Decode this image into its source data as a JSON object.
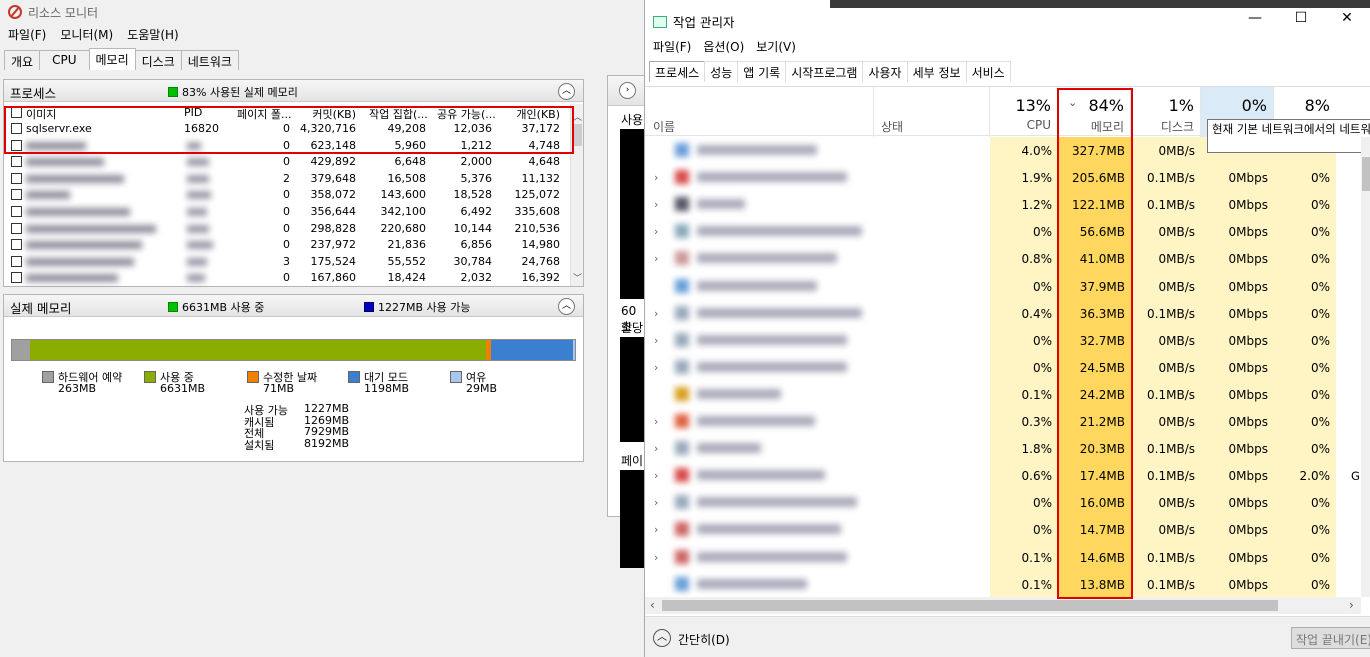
{
  "resource_monitor": {
    "title": "리소스 모니터",
    "menu": [
      "파일(F)",
      "모니터(M)",
      "도움말(H)"
    ],
    "tabs": [
      "개요",
      "CPU",
      "메모리",
      "디스크",
      "네트워크"
    ],
    "active_tab": "메모리",
    "process_panel": {
      "title": "프로세스",
      "summary": "83% 사용된 실제 메모리",
      "columns": [
        "이미지",
        "PID",
        "페이지 폴...",
        "커밋(KB)",
        "작업 집합(...",
        "공유 가능(...",
        "개인(KB)"
      ],
      "rows": [
        {
          "image": "sqlservr.exe",
          "pid": "16820",
          "faults": "0",
          "commit": "4,320,716",
          "working": "49,208",
          "shareable": "12,036",
          "private": "37,172"
        },
        {
          "image": "",
          "pid": "",
          "faults": "0",
          "commit": "623,148",
          "working": "5,960",
          "shareable": "1,212",
          "private": "4,748"
        },
        {
          "image": "",
          "pid": "",
          "faults": "0",
          "commit": "429,892",
          "working": "6,648",
          "shareable": "2,000",
          "private": "4,648"
        },
        {
          "image": "",
          "pid": "",
          "faults": "2",
          "commit": "379,648",
          "working": "16,508",
          "shareable": "5,376",
          "private": "11,132"
        },
        {
          "image": "",
          "pid": "",
          "faults": "0",
          "commit": "358,072",
          "working": "143,600",
          "shareable": "18,528",
          "private": "125,072"
        },
        {
          "image": "",
          "pid": "",
          "faults": "0",
          "commit": "356,644",
          "working": "342,100",
          "shareable": "6,492",
          "private": "335,608"
        },
        {
          "image": "",
          "pid": "",
          "faults": "0",
          "commit": "298,828",
          "working": "220,680",
          "shareable": "10,144",
          "private": "210,536"
        },
        {
          "image": "",
          "pid": "",
          "faults": "0",
          "commit": "237,972",
          "working": "21,836",
          "shareable": "6,856",
          "private": "14,980"
        },
        {
          "image": "",
          "pid": "",
          "faults": "3",
          "commit": "175,524",
          "working": "55,552",
          "shareable": "30,784",
          "private": "24,768"
        },
        {
          "image": "",
          "pid": "",
          "faults": "0",
          "commit": "167,860",
          "working": "18,424",
          "shareable": "2,032",
          "private": "16,392"
        }
      ]
    },
    "physical_memory": {
      "title": "실제 메모리",
      "in_use_badge": "6631MB 사용 중",
      "available_badge": "1227MB 사용 가능",
      "bar": {
        "hardware": 263,
        "in_use": 6631,
        "modified": 71,
        "standby": 1198,
        "free": 29
      },
      "legend": [
        {
          "label": "하드웨어 예약",
          "value": "263MB",
          "color": "#a0a0a0"
        },
        {
          "label": "사용 중",
          "value": "6631MB",
          "color": "#8bac00"
        },
        {
          "label": "수정한 날짜",
          "value": "71MB",
          "color": "#f08000"
        },
        {
          "label": "대기 모드",
          "value": "1198MB",
          "color": "#3a7fd0"
        },
        {
          "label": "여유",
          "value": "29MB",
          "color": "#a9c6ec"
        }
      ],
      "stats": [
        {
          "label": "사용 가능",
          "value": "1227MB"
        },
        {
          "label": "캐시됨",
          "value": "1269MB"
        },
        {
          "label": "전체",
          "value": "7929MB"
        },
        {
          "label": "설치됨",
          "value": "8192MB"
        }
      ]
    },
    "graph_panel": {
      "labels": [
        "사용",
        "60초",
        "할당",
        "페이"
      ]
    }
  },
  "task_manager": {
    "title": "작업 관리자",
    "window_buttons": [
      "—",
      "☐",
      "✕"
    ],
    "menu": [
      "파일(F)",
      "옵션(O)",
      "보기(V)"
    ],
    "tabs": [
      "프로세스",
      "성능",
      "앱 기록",
      "시작프로그램",
      "사용자",
      "세부 정보",
      "서비스"
    ],
    "active_tab": "프로세스",
    "columns": {
      "name": "이름",
      "status": "상태",
      "cpu": {
        "pct": "13%",
        "label": "CPU"
      },
      "memory": {
        "pct": "84%",
        "label": "메모리"
      },
      "disk": {
        "pct": "1%",
        "label": "디스크"
      },
      "network": {
        "pct": "0%",
        "label": ""
      },
      "gpu": {
        "pct": "8%",
        "label": ""
      }
    },
    "tooltip": "현재 기본 네트워크에서의 네트워크 이용률",
    "rows": [
      {
        "cpu": "4.0%",
        "mem": "327.7MB",
        "disk": "0MB/s",
        "net": "",
        "gpu": "",
        "expand": false,
        "icon": "#6a9fd8"
      },
      {
        "cpu": "1.9%",
        "mem": "205.6MB",
        "disk": "0.1MB/s",
        "net": "0Mbps",
        "gpu": "0%",
        "expand": true,
        "icon": "#d84a4a"
      },
      {
        "cpu": "1.2%",
        "mem": "122.1MB",
        "disk": "0.1MB/s",
        "net": "0Mbps",
        "gpu": "0%",
        "expand": true,
        "icon": "#556"
      },
      {
        "cpu": "0%",
        "mem": "56.6MB",
        "disk": "0MB/s",
        "net": "0Mbps",
        "gpu": "0%",
        "expand": true,
        "icon": "#8ab"
      },
      {
        "cpu": "0.8%",
        "mem": "41.0MB",
        "disk": "0MB/s",
        "net": "0Mbps",
        "gpu": "0%",
        "expand": true,
        "icon": "#c99"
      },
      {
        "cpu": "0%",
        "mem": "37.9MB",
        "disk": "0MB/s",
        "net": "0Mbps",
        "gpu": "0%",
        "expand": false,
        "icon": "#6a9fd8"
      },
      {
        "cpu": "0.4%",
        "mem": "36.3MB",
        "disk": "0.1MB/s",
        "net": "0Mbps",
        "gpu": "0%",
        "expand": true,
        "icon": "#9ab"
      },
      {
        "cpu": "0%",
        "mem": "32.7MB",
        "disk": "0MB/s",
        "net": "0Mbps",
        "gpu": "0%",
        "expand": true,
        "icon": "#9ab"
      },
      {
        "cpu": "0%",
        "mem": "24.5MB",
        "disk": "0MB/s",
        "net": "0Mbps",
        "gpu": "0%",
        "expand": true,
        "icon": "#9ab"
      },
      {
        "cpu": "0.1%",
        "mem": "24.2MB",
        "disk": "0.1MB/s",
        "net": "0Mbps",
        "gpu": "0%",
        "expand": false,
        "icon": "#d9a020"
      },
      {
        "cpu": "0.3%",
        "mem": "21.2MB",
        "disk": "0MB/s",
        "net": "0Mbps",
        "gpu": "0%",
        "expand": true,
        "icon": "#e06040"
      },
      {
        "cpu": "1.8%",
        "mem": "20.3MB",
        "disk": "0.1MB/s",
        "net": "0Mbps",
        "gpu": "0%",
        "expand": true,
        "icon": "#9ab"
      },
      {
        "cpu": "0.6%",
        "mem": "17.4MB",
        "disk": "0.1MB/s",
        "net": "0Mbps",
        "gpu": "2.0%",
        "expand": true,
        "icon": "#d84a4a"
      },
      {
        "cpu": "0%",
        "mem": "16.0MB",
        "disk": "0MB/s",
        "net": "0Mbps",
        "gpu": "0%",
        "expand": true,
        "icon": "#9ab"
      },
      {
        "cpu": "0%",
        "mem": "14.7MB",
        "disk": "0MB/s",
        "net": "0Mbps",
        "gpu": "0%",
        "expand": true,
        "icon": "#c66"
      },
      {
        "cpu": "0.1%",
        "mem": "14.6MB",
        "disk": "0.1MB/s",
        "net": "0Mbps",
        "gpu": "0%",
        "expand": true,
        "icon": "#c66"
      },
      {
        "cpu": "0.1%",
        "mem": "13.8MB",
        "disk": "0.1MB/s",
        "net": "0Mbps",
        "gpu": "0%",
        "expand": false,
        "icon": "#6a9fd8"
      }
    ],
    "gpu_engine_partial": "GP",
    "footer_less_details": "간단히(D)",
    "footer_end_task": "작업 끝내기(E)"
  }
}
